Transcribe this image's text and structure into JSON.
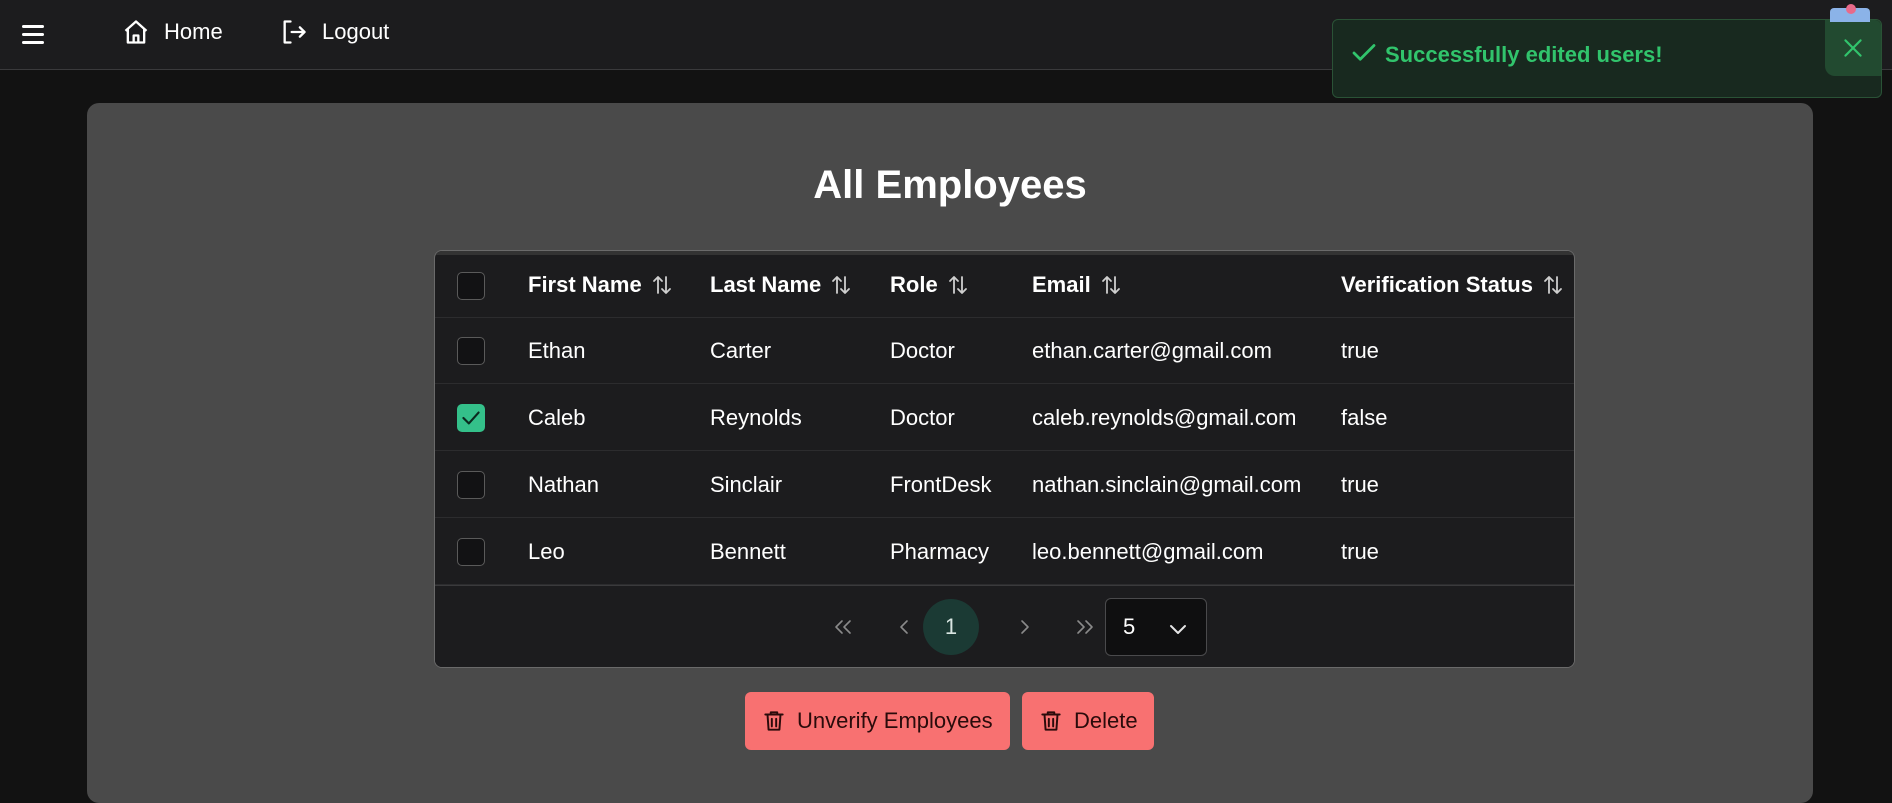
{
  "nav": {
    "home_label": "Home",
    "logout_label": "Logout"
  },
  "toast": {
    "message": "Successfully edited users!",
    "accent": "#31c46c"
  },
  "page": {
    "title": "All Employees"
  },
  "table": {
    "columns": [
      "First Name",
      "Last Name",
      "Role",
      "Email",
      "Verification Status"
    ],
    "rows": [
      {
        "first": "Ethan",
        "last": "Carter",
        "role": "Doctor",
        "email": "ethan.carter@gmail.com",
        "verified": "true",
        "selected": false
      },
      {
        "first": "Caleb",
        "last": "Reynolds",
        "role": "Doctor",
        "email": "caleb.reynolds@gmail.com",
        "verified": "false",
        "selected": true
      },
      {
        "first": "Nathan",
        "last": "Sinclair",
        "role": "FrontDesk",
        "email": "nathan.sinclain@gmail.com",
        "verified": "true",
        "selected": false
      },
      {
        "first": "Leo",
        "last": "Bennett",
        "role": "Pharmacy",
        "email": "leo.bennett@gmail.com",
        "verified": "true",
        "selected": false
      }
    ]
  },
  "pagination": {
    "current_page": "1",
    "rows_per_page": "5"
  },
  "actions": {
    "unverify_label": "Unverify Employees",
    "delete_label": "Delete",
    "danger_color": "#f87171"
  }
}
